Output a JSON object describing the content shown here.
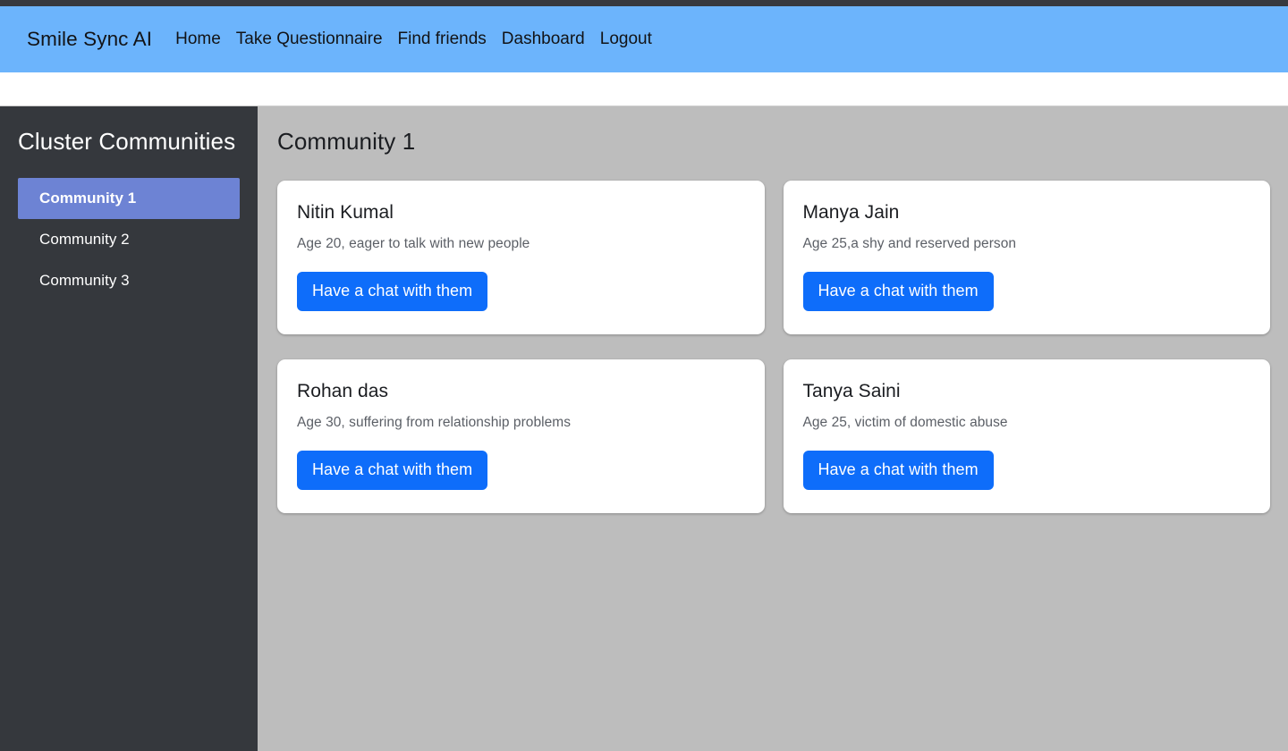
{
  "navbar": {
    "brand": "Smile Sync AI",
    "links": [
      {
        "label": "Home"
      },
      {
        "label": "Take Questionnaire"
      },
      {
        "label": "Find friends"
      },
      {
        "label": "Dashboard"
      },
      {
        "label": "Logout"
      }
    ]
  },
  "sidebar": {
    "title": "Cluster Communities",
    "items": [
      {
        "label": "Community 1",
        "active": true
      },
      {
        "label": "Community 2",
        "active": false
      },
      {
        "label": "Community 3",
        "active": false
      }
    ]
  },
  "main": {
    "title": "Community 1",
    "cards": [
      {
        "name": "Nitin Kumal",
        "description": "Age 20, eager to talk with new people",
        "button_label": "Have a chat with them"
      },
      {
        "name": "Manya Jain",
        "description": "Age 25,a shy and reserved person",
        "button_label": "Have a chat with them"
      },
      {
        "name": "Rohan das",
        "description": "Age 30, suffering from relationship problems",
        "button_label": "Have a chat with them"
      },
      {
        "name": "Tanya Saini",
        "description": "Age 25, victim of domestic abuse",
        "button_label": "Have a chat with them"
      }
    ]
  },
  "colors": {
    "navbar_background": "#6cb4fc",
    "sidebar_background": "#35383d",
    "sidebar_active": "#6d83d4",
    "content_background": "#bdbdbd",
    "button_primary": "#0e6dfa",
    "card_background": "#ffffff",
    "top_strip": "#37393f"
  }
}
